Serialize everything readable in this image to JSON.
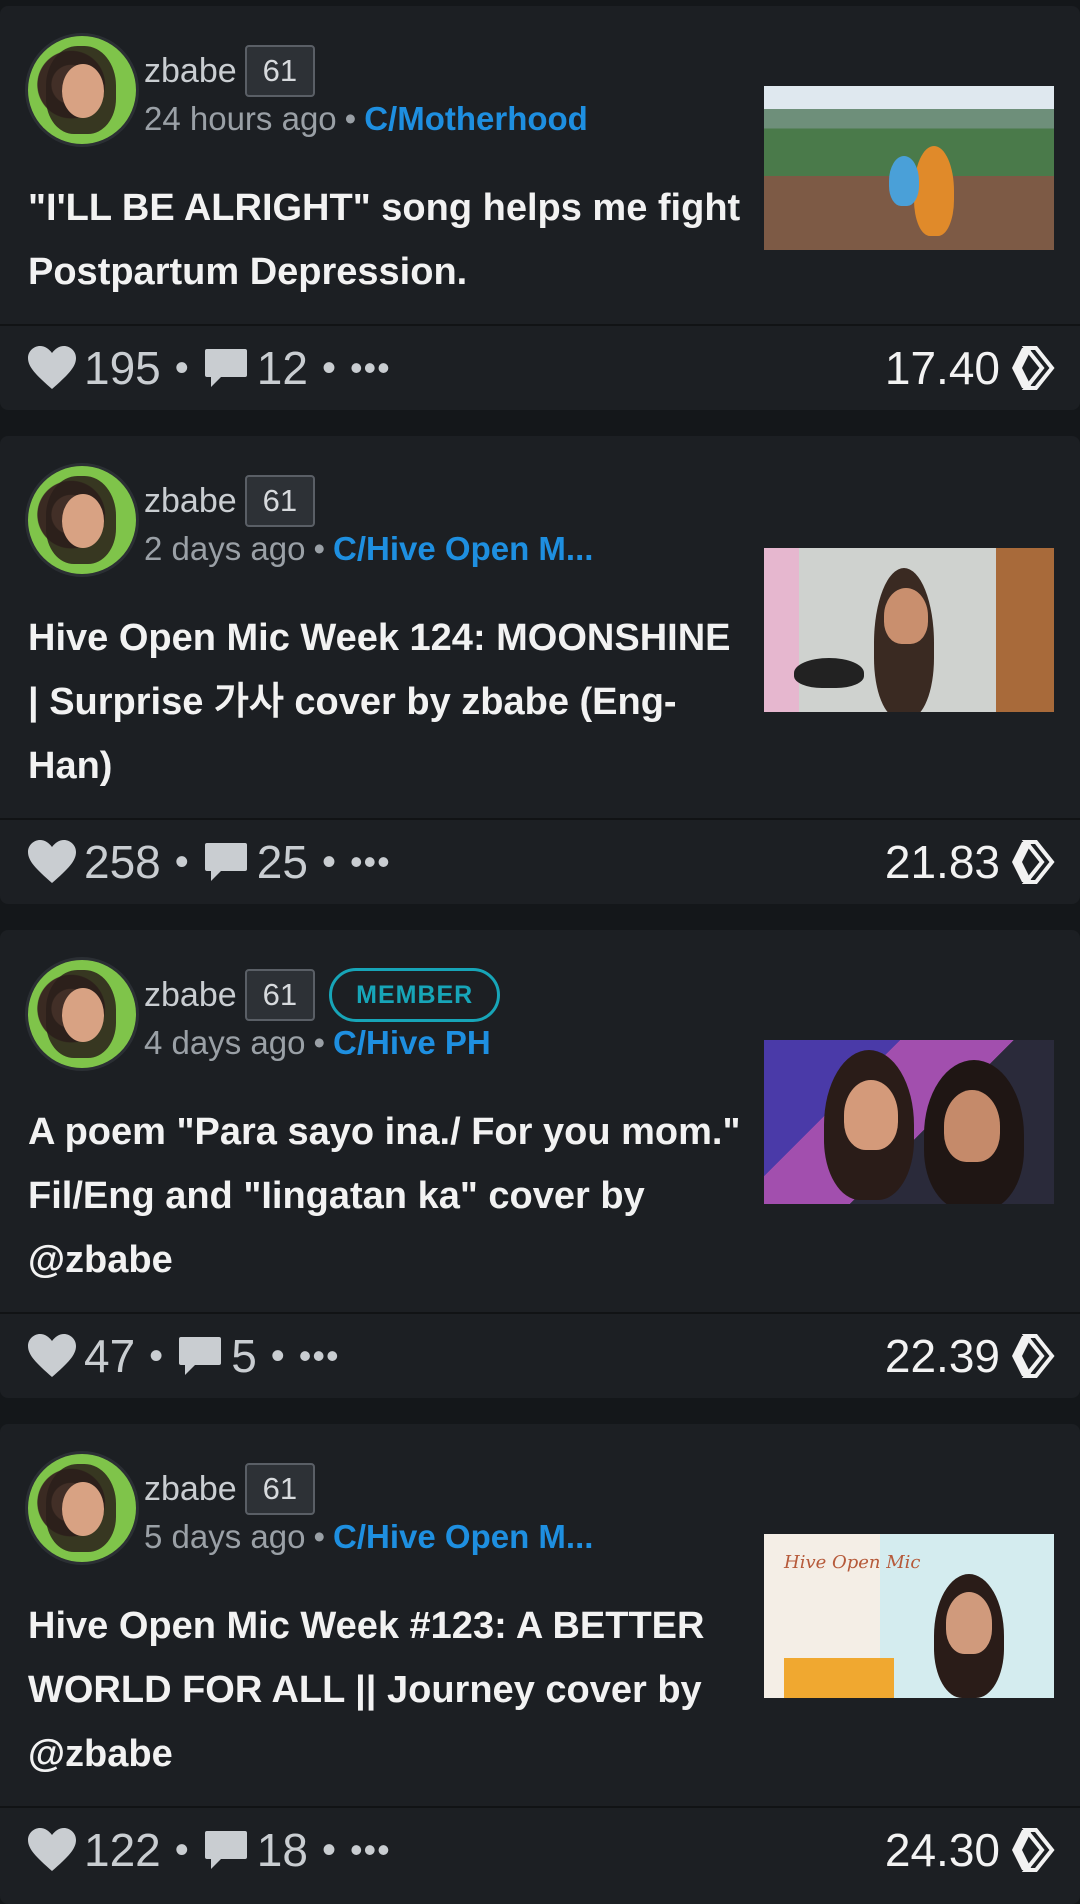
{
  "posts": [
    {
      "author": "zbabe",
      "reputation": "61",
      "badge": "",
      "time": "24 hours ago",
      "community": "C/Motherhood",
      "title": "\"I'LL BE ALRIGHT\" song helps me fight Postpartum Depression.",
      "votes": "195",
      "comments": "12",
      "payout": "17.40"
    },
    {
      "author": "zbabe",
      "reputation": "61",
      "badge": "",
      "time": "2 days ago",
      "community": "C/Hive Open M...",
      "title": "Hive Open Mic Week 124: MOONSHINE | Surprise 가사 cover by zbabe (Eng-Han)",
      "votes": "258",
      "comments": "25",
      "payout": "21.83"
    },
    {
      "author": "zbabe",
      "reputation": "61",
      "badge": "MEMBER",
      "time": "4 days ago",
      "community": "C/Hive PH",
      "title": "A poem \"Para sayo ina./ For you mom.\" Fil/Eng and \"Iingatan ka\" cover by @zbabe",
      "votes": "47",
      "comments": "5",
      "payout": "22.39"
    },
    {
      "author": "zbabe",
      "reputation": "61",
      "badge": "",
      "time": "5 days ago",
      "community": "C/Hive Open M...",
      "title": "Hive Open Mic Week #123: A BETTER WORLD FOR ALL || Journey cover by @zbabe",
      "votes": "122",
      "comments": "18",
      "payout": "24.30"
    }
  ],
  "separator_dot": "•",
  "more_glyph": "•••",
  "thumb4_overlay": "Hive Open Mic",
  "colors": {
    "background": "#14171a",
    "card": "#1c1f23",
    "link": "#1e8fe0",
    "member_badge": "#17a5b8"
  }
}
